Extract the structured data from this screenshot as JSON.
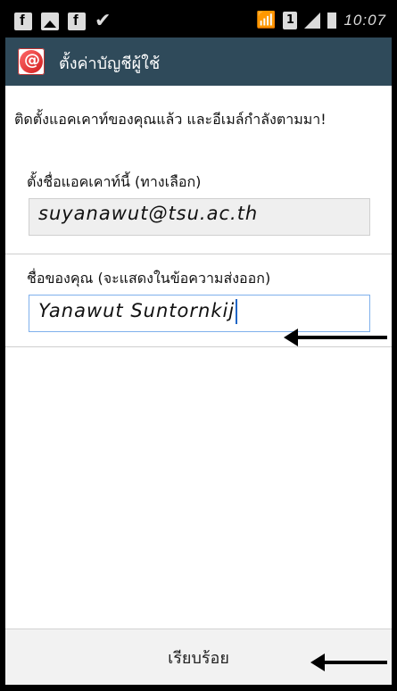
{
  "status_bar": {
    "time": "10:07",
    "icons": [
      "facebook-icon",
      "picture-icon",
      "facebook-icon",
      "check-icon",
      "wifi-icon",
      "sim-icon",
      "signal-icon",
      "battery-icon"
    ]
  },
  "action_bar": {
    "title": "ตั้งค่าบัญชีผู้ใช้",
    "icon": "email-app-icon",
    "color": "#2f4a5a"
  },
  "content": {
    "intro": "ติดตั้งแอคเคาท์ของคุณแล้ว และอีเมล์กำลังตามมา!",
    "account_name": {
      "label": "ตั้งชื่อแอคเคาท์นี้ (ทางเลือก)",
      "value": "suyanawut@tsu.ac.th"
    },
    "your_name": {
      "label": "ชื่อของคุณ (จะแสดงในข้อความส่งออก)",
      "value": "Yanawut Suntornkij"
    }
  },
  "footer": {
    "done_label": "เรียบร้อย"
  }
}
